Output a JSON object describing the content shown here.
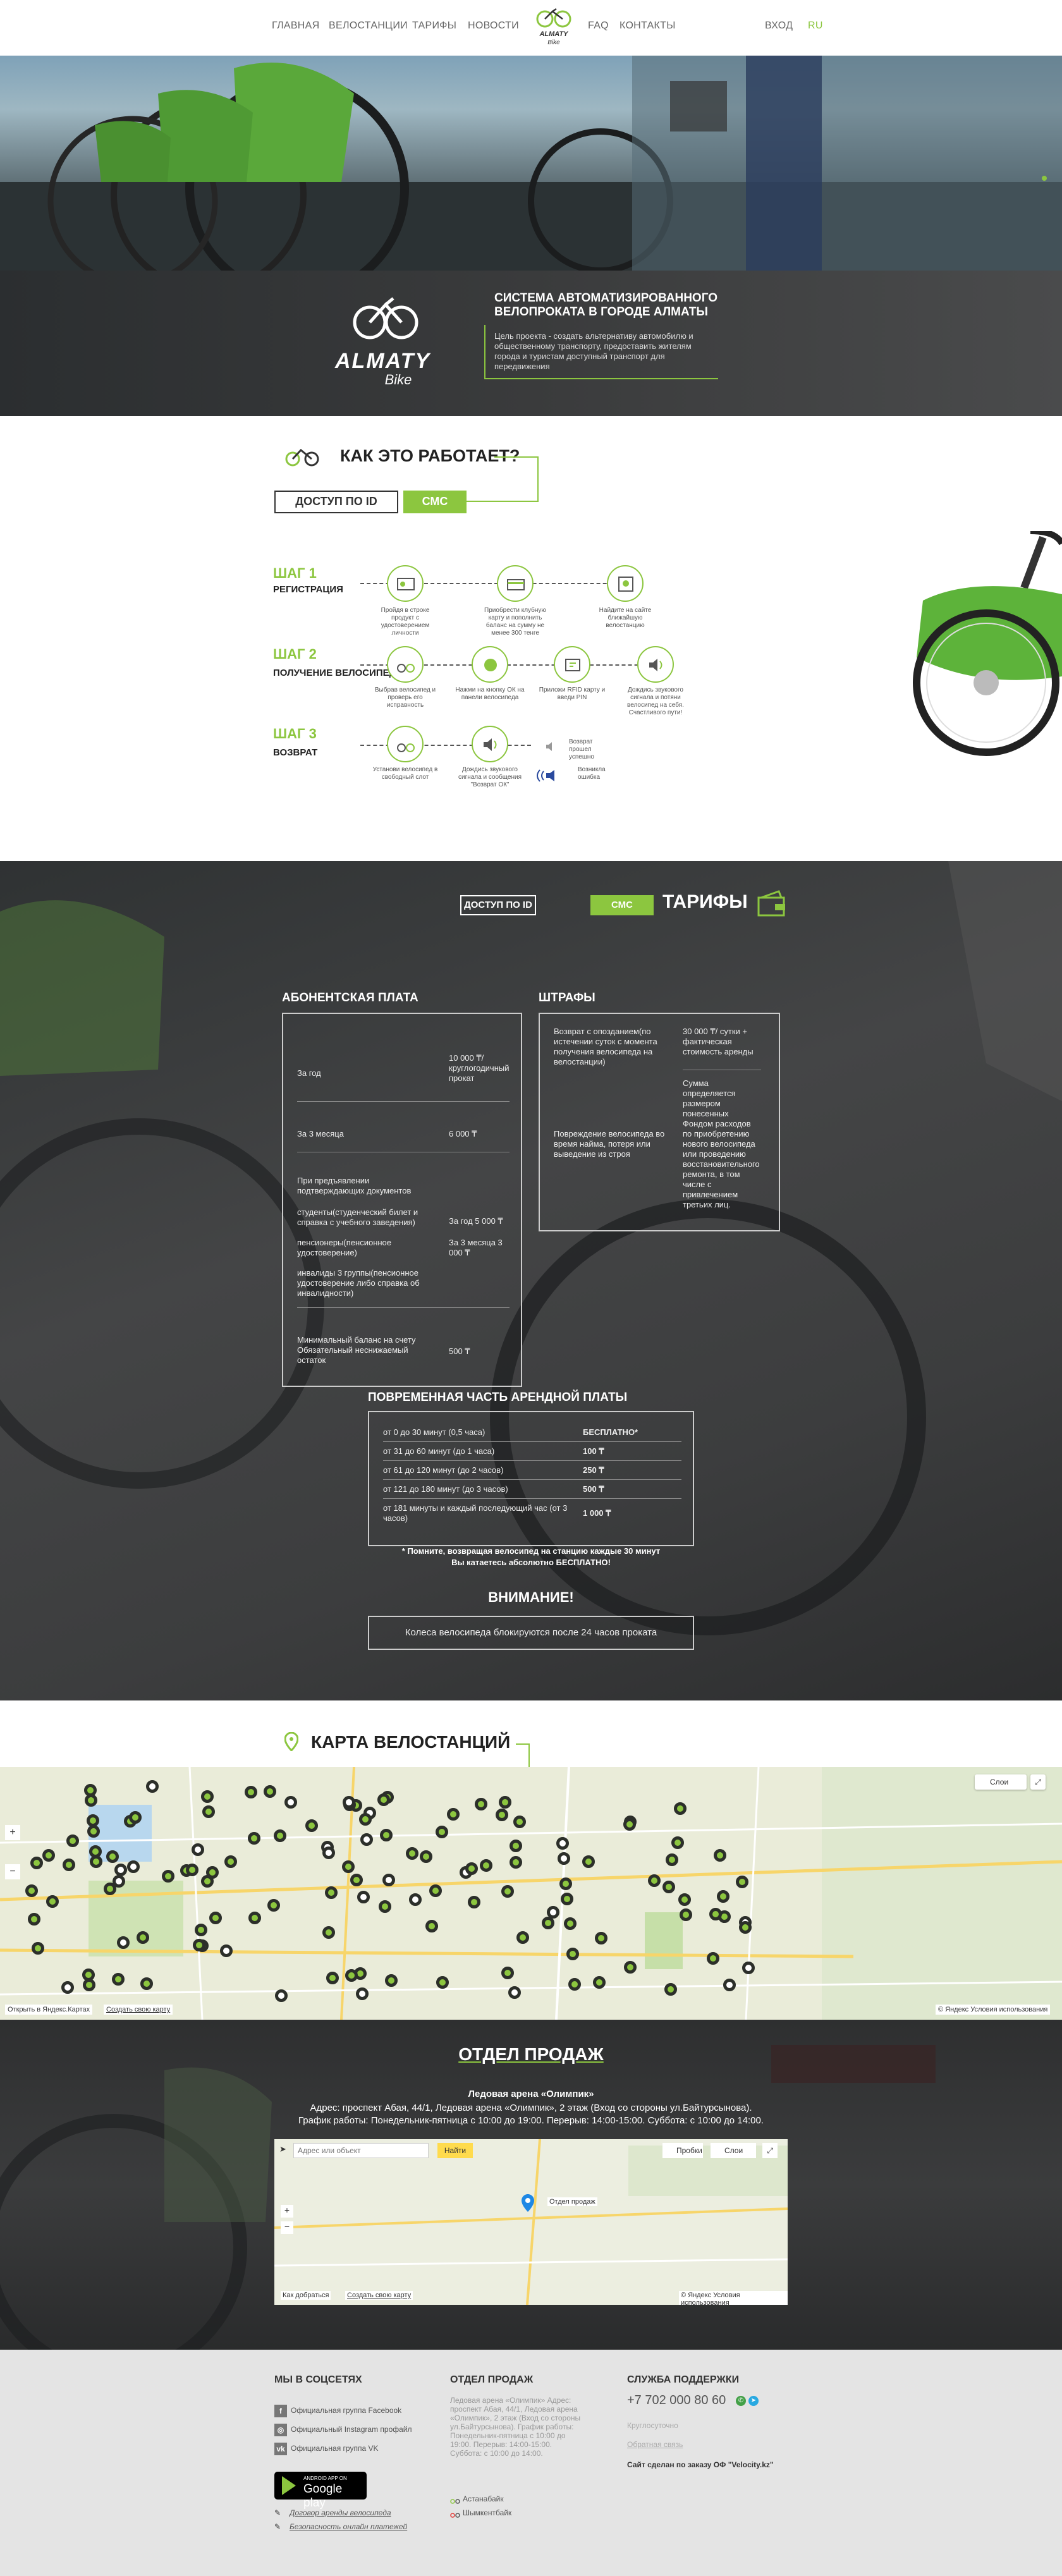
{
  "nav": {
    "items": [
      "ГЛАВНАЯ",
      "ВЕЛОСТАНЦИИ",
      "ТАРИФЫ",
      "НОВОСТИ",
      "FAQ",
      "КОНТАКТЫ"
    ],
    "login": "ВХОД",
    "lang": "RU"
  },
  "brand": {
    "logo_text": "ALMATY",
    "logo_sub": "Bike",
    "accent": "#8cc63f"
  },
  "hero": {
    "title": "СИСТЕМА АВТОМАТИЗИРОВАННОГО ВЕЛОПРОКАТА В ГОРОДЕ АЛМАТЫ",
    "desc": "Цель проекта - создать альтернативу автомобилю и общественному транспорту, предоставить жителям города и туристам доступный транспорт для передвижения"
  },
  "how": {
    "title": "КАК ЭТО РАБОТАЕТ?",
    "tab_id": "ДОСТУП ПО ID",
    "tab_sms": "СМС",
    "steps": [
      {
        "title": "ШАГ 1",
        "sub": "РЕГИСТРАЦИЯ",
        "captions": [
          "Пройдя в строке продукт с удостоверением личности",
          "Приобрести клубную карту и пополнить баланс на сумму не менее 300 тенге",
          "Найдите на сайте ближайшую велостанцию"
        ]
      },
      {
        "title": "ШАГ 2",
        "sub": "ПОЛУЧЕНИЕ ВЕЛОСИПЕДА",
        "captions": [
          "Выбрав велосипед и проверь его исправность",
          "Нажми на кнопку ОК на панели велосипеда",
          "Приложи RFID карту и введи PIN",
          "Дождись звукового сигнала и потяни велосипед на себя. Счастливого пути!"
        ]
      },
      {
        "title": "ШАГ 3",
        "sub": "ВОЗВРАТ",
        "captions": [
          "Установи велосипед в свободный слот",
          "Дождись звукового сигнала и сообщения \"Возврат ОК\"",
          "Возврат прошел успешно",
          "Возникла ошибка"
        ]
      }
    ]
  },
  "tariffs": {
    "tab_id": "ДОСТУП ПО ID",
    "tab_sms": "СМС",
    "title": "ТАРИФЫ",
    "subscription": {
      "title": "АБОНЕНТСКАЯ ПЛАТА",
      "rows": [
        {
          "name": "За год",
          "price": "10 000 ₸/ круглогодичный прокат"
        },
        {
          "name": "За 3 месяца",
          "price": "6 000 ₸"
        },
        {
          "name": "При предъявлении подтверждающих документов",
          "price": ""
        },
        {
          "name": "студенты(студенческий билет и справка с учебного заведения)",
          "price": "За год 5 000 ₸"
        },
        {
          "name": "пенсионеры(пенсионное удостоверение)",
          "price": "За 3 месяца 3 000 ₸"
        },
        {
          "name": "инвалиды 3 группы(пенсионное удостоверение либо справка об инвалидности)",
          "price": ""
        },
        {
          "name": "Минимальный баланс на счету Обязательный неснижаемый остаток",
          "price": "500 ₸"
        }
      ]
    },
    "fines": {
      "title": "ШТРАФЫ",
      "rows": [
        {
          "name": "Возврат с опозданием(по истечении суток с момента получения велосипеда на велостанции)",
          "price": "30 000 ₸/ сутки + фактическая стоимость аренды"
        },
        {
          "name": "Повреждение велосипеда во время найма, потеря или выведение из строя",
          "price": "Сумма определяется размером понесенных Фондом расходов по приобретению нового велосипеда или проведению восстановительного ремонта, в том числе с привлечением третьих лиц."
        }
      ]
    },
    "time": {
      "title": "ПОВРЕМЕННАЯ ЧАСТЬ АРЕНДНОЙ ПЛАТЫ",
      "rows": [
        {
          "name": "от 0 до 30 минут (0,5 часа)",
          "price": "БЕСПЛАТНО*"
        },
        {
          "name": "от 31 до 60 минут (до 1 часа)",
          "price": "100 ₸"
        },
        {
          "name": "от 61 до 120 минут (до 2 часов)",
          "price": "250 ₸"
        },
        {
          "name": "от 121 до 180 минут (до 3 часов)",
          "price": "500 ₸"
        },
        {
          "name": "от 181 минуты и каждый последующий час (от 3 часов)",
          "price": "1 000 ₸"
        }
      ]
    },
    "note1": "* Помните, возвращая велосипед на станцию каждые 30 минут",
    "note2": "Вы катаетесь абсолютно БЕСПЛАТНО!",
    "attention": "ВНИМАНИЕ!",
    "attention_text": "Колеса велосипеда блокируются после 24 часов проката"
  },
  "map": {
    "title": "КАРТА ВЕЛОСТАНЦИЙ",
    "layers": "Слои",
    "open_yandex": "Открыть в Яндекс.Картах",
    "create_map": "Создать свою карту",
    "terms": "© Яндекс Условия использования"
  },
  "sales": {
    "title": "ОТДЕЛ ПРОДАЖ",
    "place": "Ледовая арена «Олимпик»",
    "address": "Адрес: проспект Абая, 44/1, Ледовая арена «Олимпик», 2 этаж (Вход со стороны ул.Байтурсынова).",
    "hours": "График работы: Понедельник-пятница с 10:00 до 19:00. Перерыв: 14:00-15:00. Суббота: с 10:00 до 14:00.",
    "map": {
      "search_placeholder": "Адрес или объект",
      "find": "Найти",
      "traffic": "Пробки",
      "layers": "Слои",
      "label": "Отдел продаж",
      "route": "Как добраться",
      "create": "Создать свою карту",
      "terms": "© Яндекс Условия использования"
    }
  },
  "footer": {
    "social": {
      "title": "МЫ В СОЦСЕТЯХ",
      "items": [
        "Официальная группа Facebook",
        "Официальный Instagram профайл",
        "Официальная группа VK"
      ]
    },
    "store": {
      "line1": "ANDROID APP ON",
      "line2": "Google play"
    },
    "links": [
      "Договор аренды велосипеда",
      "Безопасность онлайн платежей"
    ],
    "sales": {
      "title": "ОТДЕЛ ПРОДАЖ",
      "text": "Ледовая арена «Олимпик» Адрес: проспект Абая, 44/1, Ледовая арена «Олимпик», 2 этаж (Вход со стороны ул.Байтурсынова). График работы: Понедельник-пятница с 10:00 до 19:00. Перерыв: 14:00-15:00. Суббота: с 10:00 до 14:00.",
      "partners": [
        "Астанабайк",
        "Шымкентбайк"
      ]
    },
    "support": {
      "title": "СЛУЖБА ПОДДЕРЖКИ",
      "phone": "+7 702 000 80 60",
      "link1": "Круглосуточно",
      "link2": "Обратная связь",
      "credit": "Сайт сделан по заказу ОФ \"Velocity.kz\""
    }
  }
}
